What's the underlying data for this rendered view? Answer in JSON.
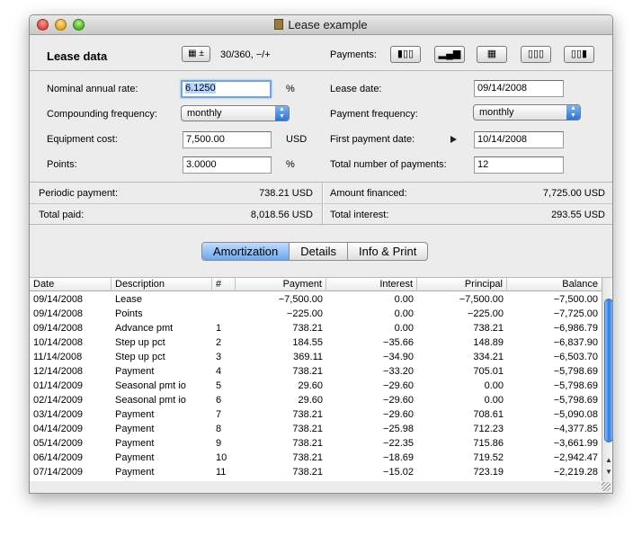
{
  "window": {
    "title": "Lease example"
  },
  "header": {
    "section_title": "Lease data",
    "calculator_button": "▦ ±",
    "day_basis": "30/360, −/+",
    "payments_label": "Payments:",
    "payment_buttons": [
      {
        "icon": "bar-chart-ascending-icon",
        "glyph": "▮▯▯"
      },
      {
        "icon": "bar-chart-stepped-icon",
        "glyph": "▂▄▆"
      },
      {
        "icon": "grid-icon",
        "glyph": "▦"
      },
      {
        "icon": "bar-chart-left-icon",
        "glyph": "▯▯▯"
      },
      {
        "icon": "bar-chart-right-icon",
        "glyph": "▯▯▮"
      }
    ]
  },
  "form": {
    "nominal_rate": {
      "label": "Nominal annual rate:",
      "value": "6.1250",
      "unit": "%"
    },
    "compounding": {
      "label": "Compounding frequency:",
      "value": "monthly"
    },
    "equipment_cost": {
      "label": "Equipment cost:",
      "value": "7,500.00",
      "unit": "USD"
    },
    "points": {
      "label": "Points:",
      "value": "3.0000",
      "unit": "%"
    },
    "lease_date": {
      "label": "Lease date:",
      "value": "09/14/2008"
    },
    "payment_frequency": {
      "label": "Payment frequency:",
      "value": "monthly"
    },
    "first_payment_date": {
      "label": "First payment date:",
      "value": "10/14/2008"
    },
    "total_payments": {
      "label": "Total number of payments:",
      "value": "12"
    }
  },
  "summary": {
    "periodic_payment": {
      "label": "Periodic payment:",
      "value": "738.21 USD"
    },
    "total_paid": {
      "label": "Total paid:",
      "value": "8,018.56 USD"
    },
    "amount_financed": {
      "label": "Amount financed:",
      "value": "7,725.00 USD"
    },
    "total_interest": {
      "label": "Total interest:",
      "value": "293.55 USD"
    }
  },
  "tabs": [
    {
      "label": "Amortization",
      "active": true
    },
    {
      "label": "Details",
      "active": false
    },
    {
      "label": "Info & Print",
      "active": false
    }
  ],
  "table": {
    "columns": [
      "Date",
      "Description",
      "#",
      "Payment",
      "Interest",
      "Principal",
      "Balance"
    ],
    "rows": [
      [
        "09/14/2008",
        "Lease",
        "",
        "−7,500.00",
        "0.00",
        "−7,500.00",
        "−7,500.00"
      ],
      [
        "09/14/2008",
        "Points",
        "",
        "−225.00",
        "0.00",
        "−225.00",
        "−7,725.00"
      ],
      [
        "09/14/2008",
        "Advance pmt",
        "1",
        "738.21",
        "0.00",
        "738.21",
        "−6,986.79"
      ],
      [
        "10/14/2008",
        "Step up pct",
        "2",
        "184.55",
        "−35.66",
        "148.89",
        "−6,837.90"
      ],
      [
        "11/14/2008",
        "Step up pct",
        "3",
        "369.11",
        "−34.90",
        "334.21",
        "−6,503.70"
      ],
      [
        "12/14/2008",
        "Payment",
        "4",
        "738.21",
        "−33.20",
        "705.01",
        "−5,798.69"
      ],
      [
        "01/14/2009",
        "Seasonal pmt io",
        "5",
        "29.60",
        "−29.60",
        "0.00",
        "−5,798.69"
      ],
      [
        "02/14/2009",
        "Seasonal pmt io",
        "6",
        "29.60",
        "−29.60",
        "0.00",
        "−5,798.69"
      ],
      [
        "03/14/2009",
        "Payment",
        "7",
        "738.21",
        "−29.60",
        "708.61",
        "−5,090.08"
      ],
      [
        "04/14/2009",
        "Payment",
        "8",
        "738.21",
        "−25.98",
        "712.23",
        "−4,377.85"
      ],
      [
        "05/14/2009",
        "Payment",
        "9",
        "738.21",
        "−22.35",
        "715.86",
        "−3,661.99"
      ],
      [
        "06/14/2009",
        "Payment",
        "10",
        "738.21",
        "−18.69",
        "719.52",
        "−2,942.47"
      ],
      [
        "07/14/2009",
        "Payment",
        "11",
        "738.21",
        "−15.02",
        "723.19",
        "−2,219.28"
      ]
    ]
  }
}
